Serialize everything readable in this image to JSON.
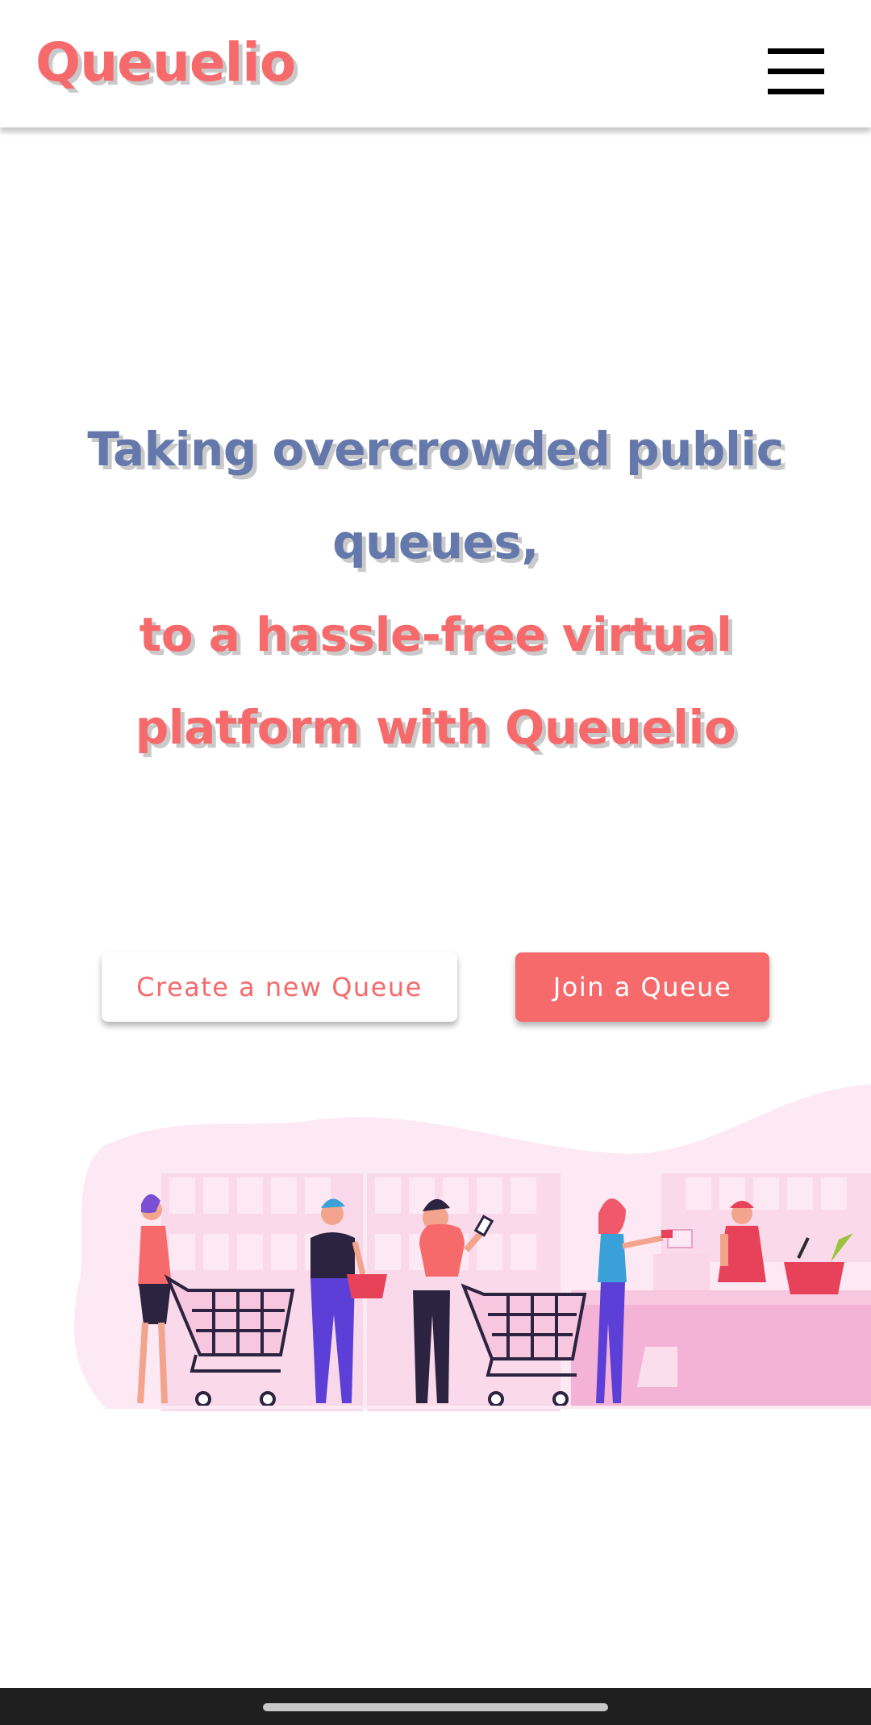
{
  "header": {
    "brand": "Queuelio",
    "menu_icon": "hamburger-menu-icon"
  },
  "hero": {
    "line1": "Taking overcrowded public",
    "line2": "queues,",
    "line3": "to a hassle-free virtual",
    "line4": "platform with Queuelio"
  },
  "actions": {
    "create_label": "Create a new Queue",
    "join_label": "Join a Queue"
  },
  "illustration": {
    "subject": "queue-at-checkout-illustration"
  },
  "colors": {
    "brand": "#f66a6c",
    "primary_text": "#6478ab",
    "text_shadow": "#c9c9c9",
    "illustration_pink": "#f7c6df",
    "illustration_purple": "#5b3fd6"
  }
}
